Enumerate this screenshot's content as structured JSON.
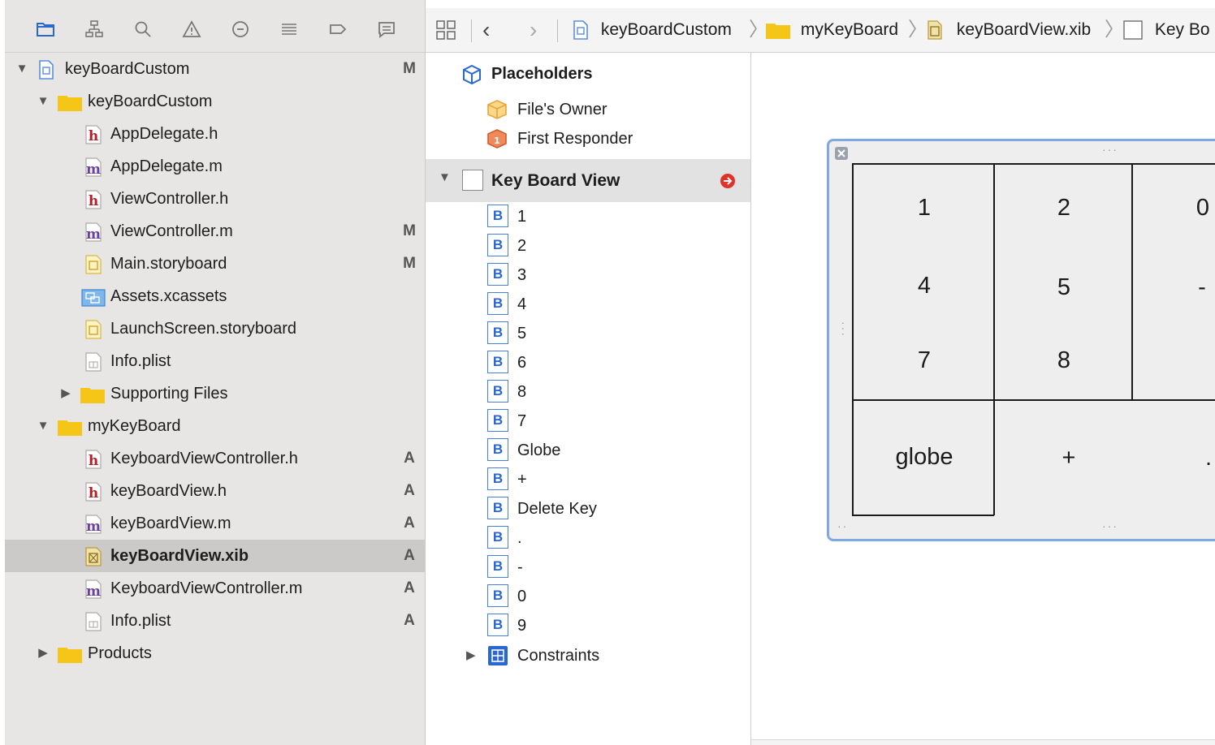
{
  "navigator": {
    "toolbar_icons": [
      "folder-icon",
      "hierarchy-icon",
      "search-icon",
      "warning-icon",
      "breakpoint-diamond-icon",
      "list-icon",
      "tag-icon",
      "comment-icon"
    ],
    "items": [
      {
        "label": "keyBoardCustom",
        "badge": "M",
        "kind": "project",
        "disclosure": "open"
      },
      {
        "label": "keyBoardCustom",
        "badge": "",
        "kind": "folder",
        "disclosure": "open"
      },
      {
        "label": "AppDelegate.h",
        "badge": "",
        "kind": "h"
      },
      {
        "label": "AppDelegate.m",
        "badge": "",
        "kind": "m"
      },
      {
        "label": "ViewController.h",
        "badge": "",
        "kind": "h"
      },
      {
        "label": "ViewController.m",
        "badge": "M",
        "kind": "m"
      },
      {
        "label": "Main.storyboard",
        "badge": "M",
        "kind": "storyboard"
      },
      {
        "label": "Assets.xcassets",
        "badge": "",
        "kind": "assets"
      },
      {
        "label": "LaunchScreen.storyboard",
        "badge": "",
        "kind": "storyboard"
      },
      {
        "label": "Info.plist",
        "badge": "",
        "kind": "plist"
      },
      {
        "label": "Supporting Files",
        "badge": "",
        "kind": "folder",
        "disclosure": "closed"
      },
      {
        "label": "myKeyBoard",
        "badge": "",
        "kind": "folder",
        "disclosure": "open"
      },
      {
        "label": "KeyboardViewController.h",
        "badge": "A",
        "kind": "h"
      },
      {
        "label": "keyBoardView.h",
        "badge": "A",
        "kind": "h"
      },
      {
        "label": "keyBoardView.m",
        "badge": "A",
        "kind": "m"
      },
      {
        "label": "keyBoardView.xib",
        "badge": "A",
        "kind": "xib",
        "selected": true
      },
      {
        "label": "KeyboardViewController.m",
        "badge": "A",
        "kind": "m"
      },
      {
        "label": "Info.plist",
        "badge": "A",
        "kind": "plist"
      },
      {
        "label": "Products",
        "badge": "",
        "kind": "folder",
        "disclosure": "closed"
      }
    ]
  },
  "jumpbar": {
    "crumbs": [
      "keyBoardCustom",
      "myKeyBoard",
      "keyBoardView.xib",
      "Key Bo"
    ]
  },
  "outline": {
    "placeholders_title": "Placeholders",
    "files_owner": "File's Owner",
    "first_responder": "First Responder",
    "view_title": "Key Board View",
    "buttons": [
      "1",
      "2",
      "3",
      "4",
      "5",
      "6",
      "8",
      "7",
      "Globe",
      "+",
      "Delete Key",
      ".",
      "-",
      "0",
      "9"
    ],
    "constraints": "Constraints"
  },
  "canvas": {
    "keys": {
      "k1": "1",
      "k2": "2",
      "k0": "0",
      "k4": "4",
      "k5": "5",
      "kminus": "-",
      "k7": "7",
      "k8": "8",
      "kglobe": "globe",
      "kplus": "+",
      "kdot": "."
    }
  },
  "colors": {
    "accent": "#2b67d1",
    "selection": "#cbcac9",
    "folder": "#f5c518",
    "header_h": "#b3202a",
    "header_m": "#6a3fa0",
    "error_badge": "#e0312a"
  }
}
